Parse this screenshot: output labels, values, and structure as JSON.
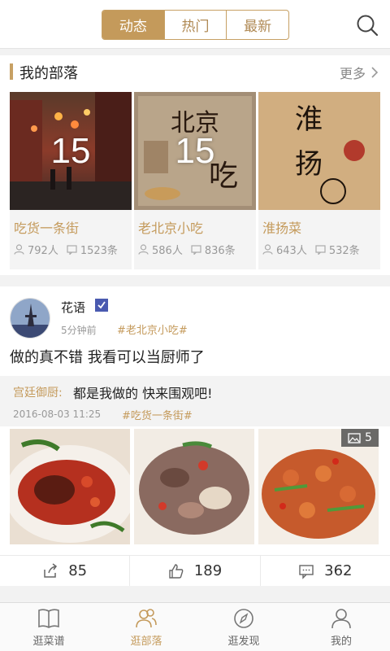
{
  "header": {
    "tabs": [
      {
        "label": "动态",
        "active": true
      },
      {
        "label": "热门",
        "active": false
      },
      {
        "label": "最新",
        "active": false
      }
    ],
    "search_icon": "search-icon"
  },
  "tribes": {
    "title": "我的部落",
    "more": "更多",
    "items": [
      {
        "name": "吃货一条街",
        "count": "15",
        "members": "792人",
        "posts": "1523条"
      },
      {
        "name": "老北京小吃",
        "count": "15",
        "members": "586人",
        "posts": "836条"
      },
      {
        "name": "淮扬菜",
        "count": "",
        "members": "643人",
        "posts": "532条"
      }
    ]
  },
  "post": {
    "author": "花语",
    "time": "5分钟前",
    "tag": "#老北京小吃#",
    "text": "做的真不错 我看可以当厨师了",
    "quote": {
      "author": "宫廷御厨:",
      "text": "都是我做的 快来围观吧!",
      "time": "2016-08-03 11:25",
      "tag": "#吃货一条街#"
    },
    "photo_count": "5",
    "actions": {
      "share": "85",
      "like": "189",
      "comment": "362"
    }
  },
  "bottom_nav": [
    {
      "label": "逛菜谱",
      "active": false
    },
    {
      "label": "逛部落",
      "active": true
    },
    {
      "label": "逛发现",
      "active": false
    },
    {
      "label": "我的",
      "active": false
    }
  ],
  "colors": {
    "accent": "#c49a5b",
    "background_gap": "#f2f2f2"
  }
}
